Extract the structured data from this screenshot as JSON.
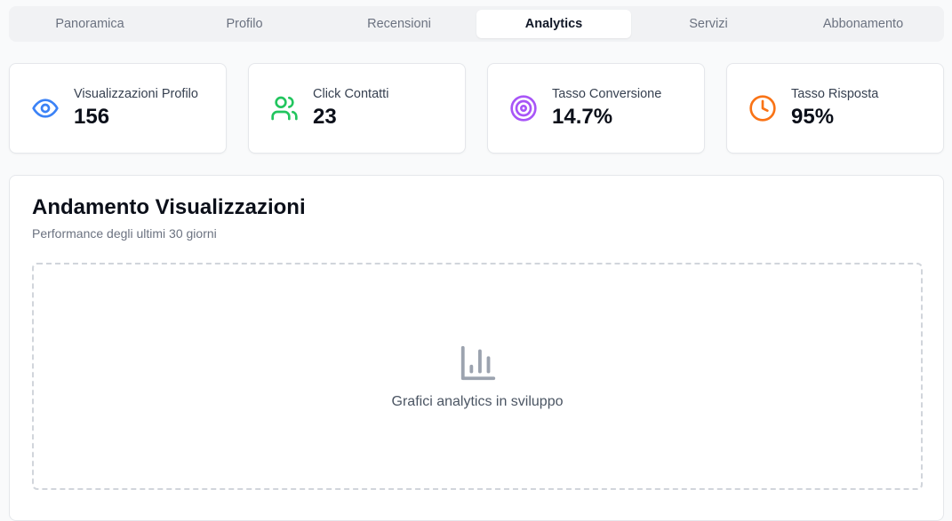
{
  "tabs": [
    {
      "label": "Panoramica",
      "active": false
    },
    {
      "label": "Profilo",
      "active": false
    },
    {
      "label": "Recensioni",
      "active": false
    },
    {
      "label": "Analytics",
      "active": true
    },
    {
      "label": "Servizi",
      "active": false
    },
    {
      "label": "Abbonamento",
      "active": false
    }
  ],
  "stats": [
    {
      "label": "Visualizzazioni Profilo",
      "value": "156",
      "icon": "eye-icon",
      "color": "#3b82f6"
    },
    {
      "label": "Click Contatti",
      "value": "23",
      "icon": "users-icon",
      "color": "#22c55e"
    },
    {
      "label": "Tasso Conversione",
      "value": "14.7%",
      "icon": "target-icon",
      "color": "#a855f7"
    },
    {
      "label": "Tasso Risposta",
      "value": "95%",
      "icon": "clock-icon",
      "color": "#f97316"
    }
  ],
  "chart_section": {
    "title": "Andamento Visualizzazioni",
    "subtitle": "Performance degli ultimi 30 giorni",
    "placeholder_icon": "bar-chart-icon",
    "placeholder_text": "Grafici analytics in sviluppo"
  }
}
